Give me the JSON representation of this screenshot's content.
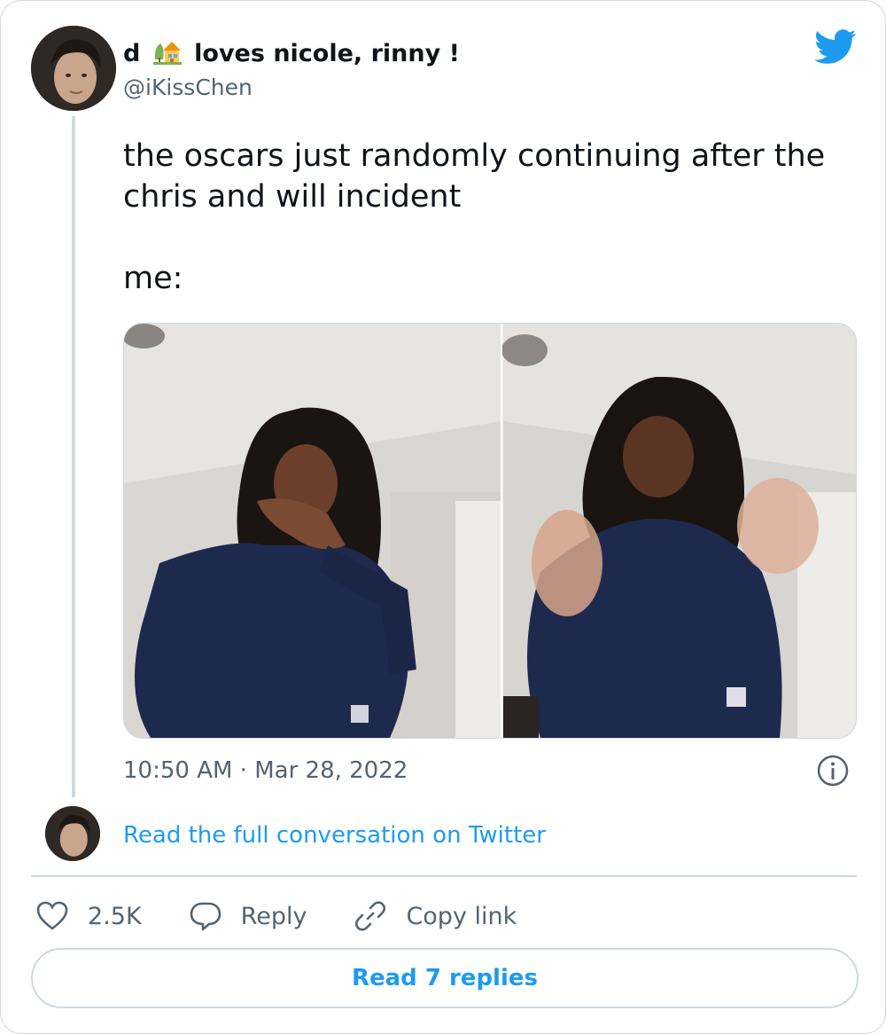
{
  "author": {
    "name_prefix": "d",
    "name_suffix": "loves nicole, rinny !",
    "handle": "@iKissChen",
    "name_emoji_icon": "house-with-garden-icon"
  },
  "tweet": {
    "text": "the oscars just randomly continuing after the chris and will incident\n\nme:",
    "timestamp": "10:50 AM · Mar 28, 2022"
  },
  "conversation_link": "Read the full conversation on Twitter",
  "actions": {
    "likes": "2.5K",
    "reply_label": "Reply",
    "copy_link_label": "Copy link"
  },
  "read_replies_label": "Read 7 replies",
  "colors": {
    "brand": "#1d9bf0",
    "text": "#0f1419",
    "secondary_text": "#536471",
    "border": "#cfd9de"
  },
  "icons": [
    "twitter-bird-icon",
    "info-icon",
    "heart-icon",
    "reply-bubble-icon",
    "link-icon"
  ]
}
